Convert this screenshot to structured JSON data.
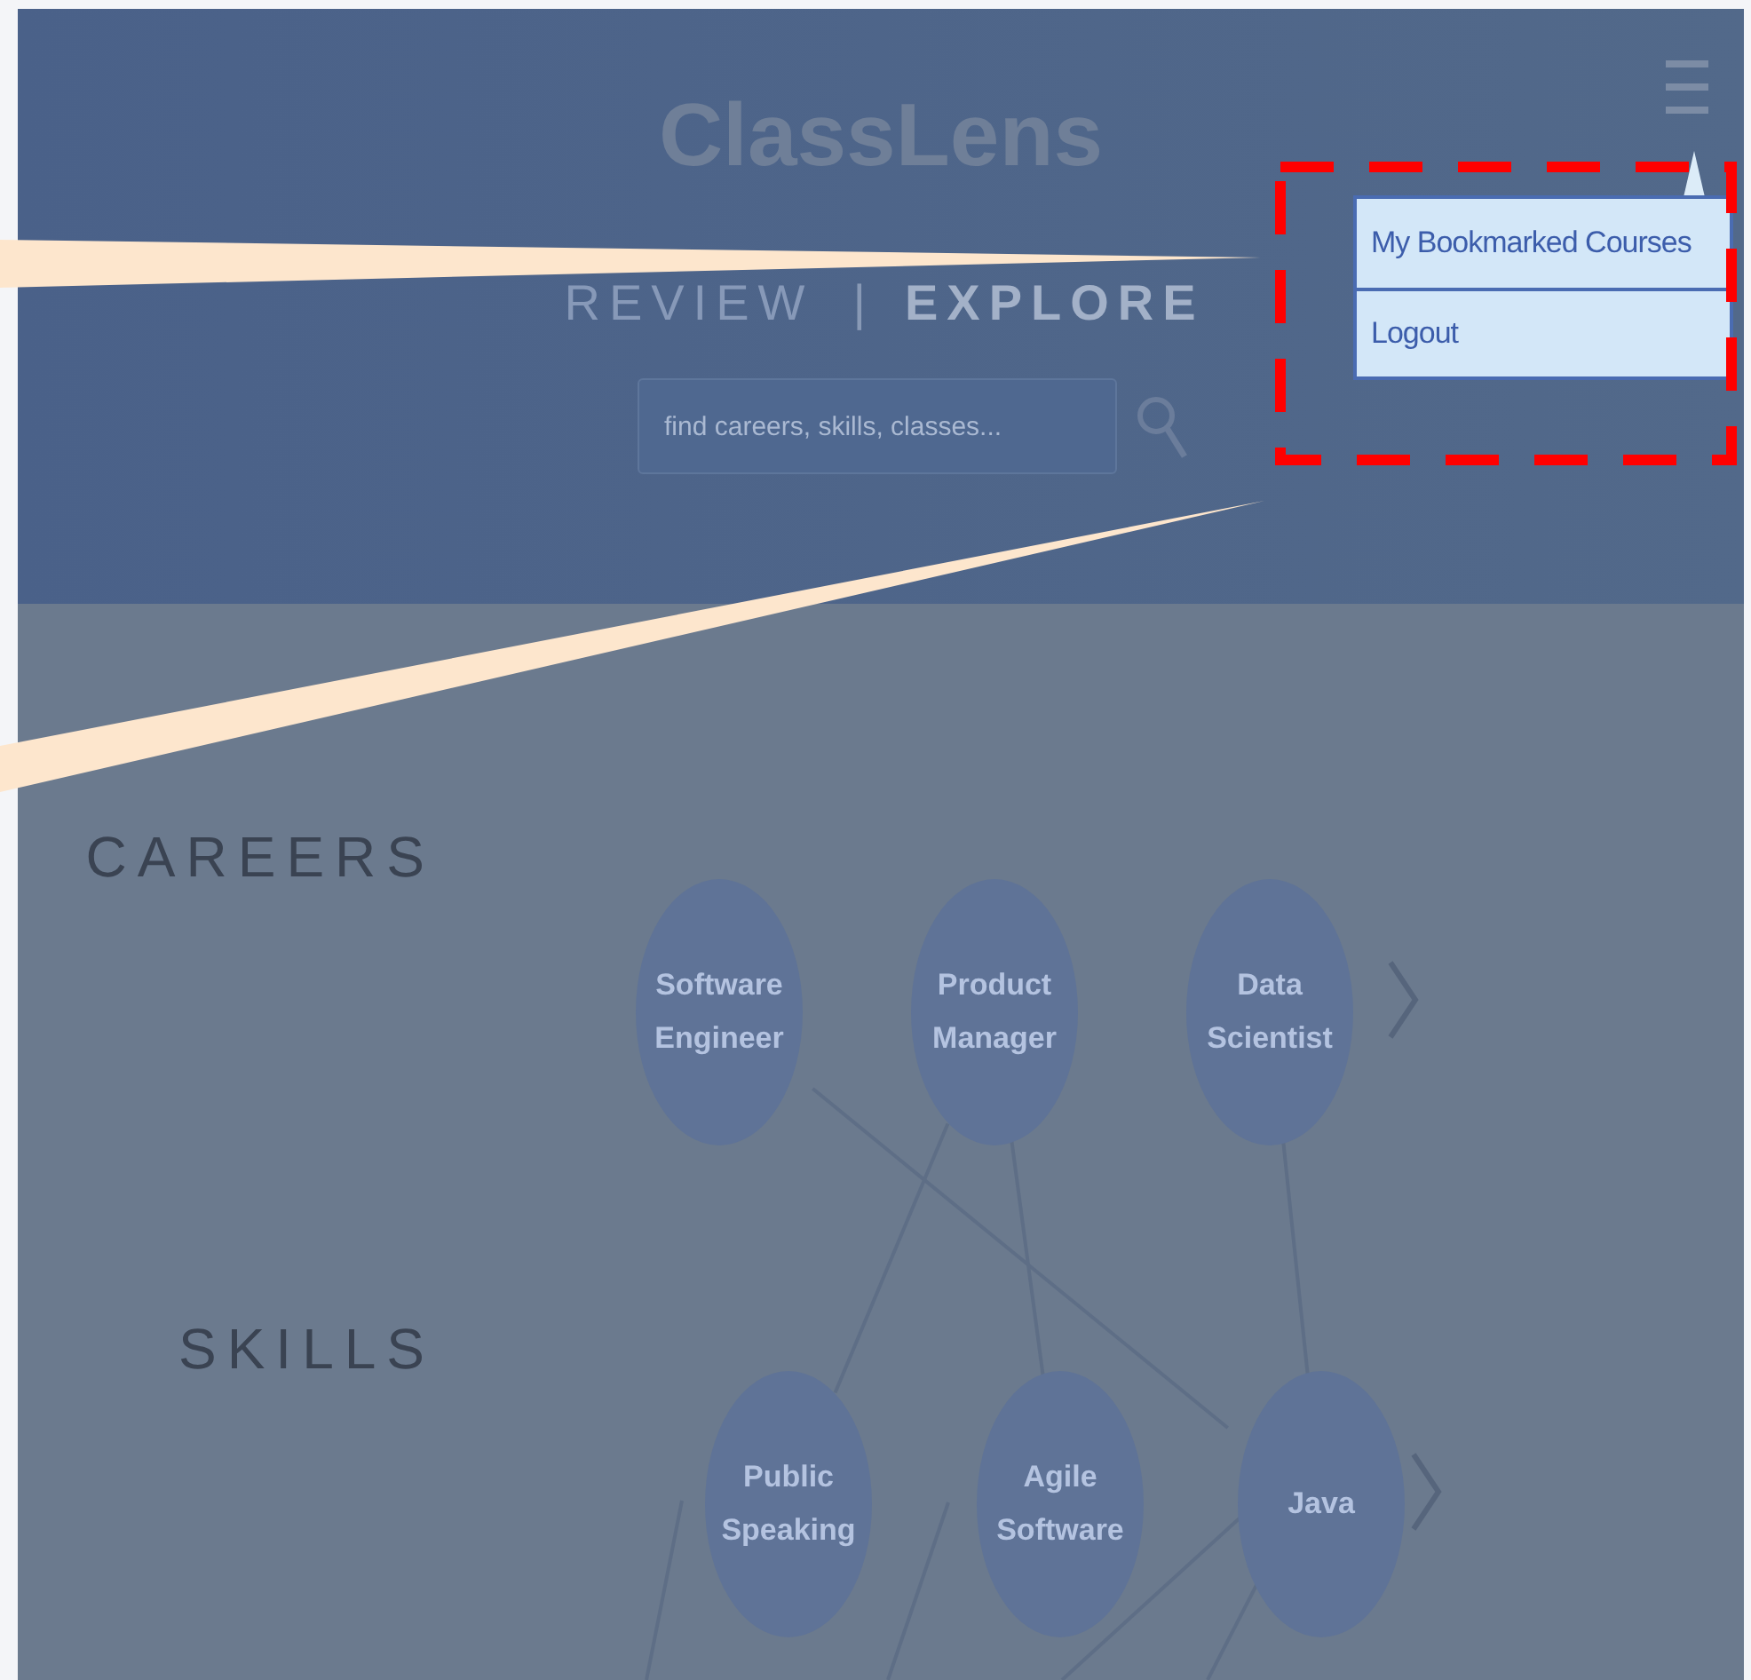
{
  "header": {
    "title": "ClassLens",
    "tabs": [
      {
        "label": "REVIEW",
        "selected": false
      },
      {
        "label": "EXPLORE",
        "selected": true
      }
    ],
    "tab_separator": "|",
    "search": {
      "placeholder": "find careers, skills, classes..."
    }
  },
  "dropdown_menu": {
    "items": [
      "My Bookmarked Courses",
      "Logout"
    ]
  },
  "rows": [
    {
      "label": "CAREERS",
      "nodes": [
        "Software Engineer",
        "Product Manager",
        "Data Scientist"
      ]
    },
    {
      "label": "SKILLS",
      "nodes": [
        "Public Speaking",
        "Agile Software",
        "Java"
      ]
    }
  ]
}
